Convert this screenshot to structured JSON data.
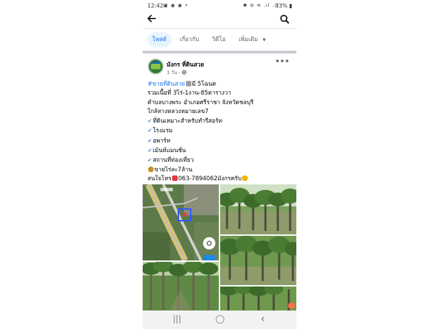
{
  "status_bar": {
    "time": "12:42",
    "left_icons": "▣ ◉ ◉ •",
    "right_icons": "✱ ⊘ ≋ .ıl .ıl",
    "battery": "33% ▮"
  },
  "top_bar": {
    "back_icon": "arrow-left-icon",
    "search_icon": "search-icon"
  },
  "tabs": [
    {
      "label": "โพสต์",
      "active": true
    },
    {
      "label": "เกี่ยวกับ",
      "active": false
    },
    {
      "label": "วิดีโอ",
      "active": false
    },
    {
      "label": "เพิ่มเติม",
      "active": false
    }
  ],
  "more_tab_caret": "▼",
  "post": {
    "page_name": "มังกร ที่ดินสวย",
    "time": "1 วัน",
    "audience_icon": "globe-icon",
    "more_label": "•••",
    "hashtag": "#ขายที่ดินสวย",
    "line1_rest": "มี 5โฉนด",
    "lines": [
      "รวมเนื้อที่ 3ไร่-1งาน-85ตารางวา",
      "ตำบลบางพระ อำเภอศรีราชา จังหวัดชลบุรี",
      "ใกล้ทางหลวงหมายเลข7"
    ],
    "checks": [
      "ที่ดินเหมาะสำหรับทำรีสอร์ท",
      "โรงแรม",
      "อพาร์ท",
      "เม้นท์แมนชั่น",
      "สถานที่ท่องเที่ยว"
    ],
    "check_mark": "✔",
    "price": "ขายไร่ละ7ล้าน",
    "contact": "สนใจโทร",
    "phone": "063-7894062มังกรครับ",
    "map_marker": "1"
  },
  "nav_bar": {
    "recent": "|||",
    "home": "◯",
    "back": "‹"
  },
  "colors": {
    "accent": "#1877f2",
    "tab_active_bg": "#e7f3ff",
    "separator": "#c9ccd1"
  }
}
